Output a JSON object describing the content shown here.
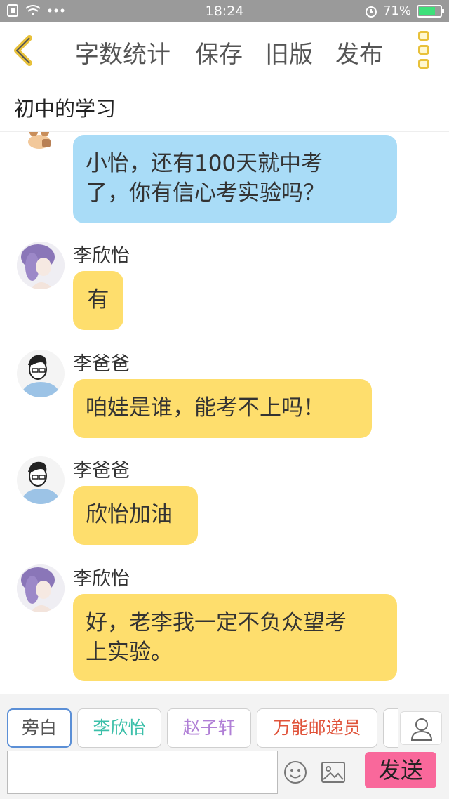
{
  "status_bar": {
    "time": "18:24",
    "battery": "71%",
    "battery_level": 0.71
  },
  "toolbar": {
    "back_icon": "chevron-left-icon",
    "word_count": "字数统计",
    "save": "保存",
    "old_version": "旧版",
    "publish": "发布",
    "more_icon": "more-icon"
  },
  "doc_title": "初中的学习",
  "messages": [
    {
      "speaker": "",
      "text": "小怡，还有100天就中考\n了，你有信心考实验吗？",
      "color": "blue"
    },
    {
      "speaker": "李欣怡",
      "text": "有",
      "color": "yellow"
    },
    {
      "speaker": "李爸爸",
      "text": "咱娃是谁，能考不上吗！",
      "color": "yellow"
    },
    {
      "speaker": "李爸爸",
      "text": "欣怡加油",
      "color": "yellow"
    },
    {
      "speaker": "李欣怡",
      "text": "好，老李我一定不负众望考\n上实验。",
      "color": "yellow"
    }
  ],
  "roles": [
    {
      "label": "旁白",
      "color": "#555555"
    },
    {
      "label": "李欣怡",
      "color": "#3bbfa9"
    },
    {
      "label": "赵子轩",
      "color": "#b07fd6"
    },
    {
      "label": "万能邮递员",
      "color": "#e0533a"
    }
  ],
  "composer": {
    "placeholder": "",
    "send": "发送"
  },
  "colors": {
    "bubble_blue": "#a9dcf7",
    "bubble_yellow": "#fede6d",
    "send": "#f9689b",
    "accent": "#e8c13a"
  }
}
